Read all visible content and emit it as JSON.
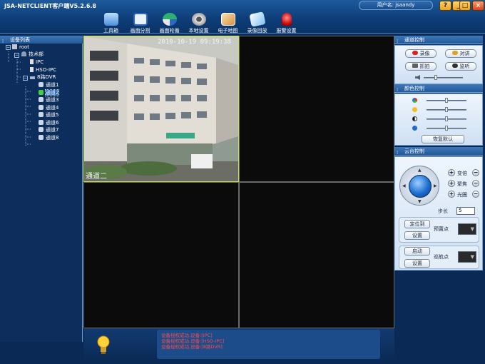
{
  "app": {
    "title": "JSA-NETCLIENT客户端V5.2.6.8",
    "user": "用户名: jsaandy"
  },
  "window_buttons": {
    "help": "?",
    "minimize": "_",
    "maximize": "□",
    "close": "×"
  },
  "toolbar": [
    {
      "label": "工具箱",
      "icon": "toolbox-icon",
      "color": "#5aa0e0"
    },
    {
      "label": "画面分割",
      "icon": "split-screen-icon",
      "color": "#5aa0e0"
    },
    {
      "label": "画面轮循",
      "icon": "cycle-icon",
      "color": "#2fa870"
    },
    {
      "label": "本地设置",
      "icon": "gear-icon",
      "color": "#d8d8d8"
    },
    {
      "label": "电子地图",
      "icon": "map-icon",
      "color": "#f0c080"
    },
    {
      "label": "录像回放",
      "icon": "playback-icon",
      "color": "#7cc0f0"
    },
    {
      "label": "报警设置",
      "icon": "alarm-icon",
      "color": "#e03030"
    }
  ],
  "left_panel": {
    "header": "设备列表",
    "tree": [
      {
        "label": "root",
        "level": 0,
        "icon": "root-icon"
      },
      {
        "label": "技术部",
        "level": 1,
        "icon": "department-icon"
      },
      {
        "label": "IPC",
        "level": 2,
        "icon": "device-icon"
      },
      {
        "label": "HSO-IPC",
        "level": 2,
        "icon": "device-icon"
      },
      {
        "label": "8路DVR",
        "level": 2,
        "icon": "dvr-icon"
      },
      {
        "label": "通道1",
        "level": 3,
        "icon": "camera-icon"
      },
      {
        "label": "通道2",
        "level": 3,
        "icon": "camera-active-icon",
        "selected": true
      },
      {
        "label": "通道3",
        "level": 3,
        "icon": "camera-icon"
      },
      {
        "label": "通道4",
        "level": 3,
        "icon": "camera-icon"
      },
      {
        "label": "通道5",
        "level": 3,
        "icon": "camera-icon"
      },
      {
        "label": "通道6",
        "level": 3,
        "icon": "camera-icon"
      },
      {
        "label": "通道7",
        "level": 3,
        "icon": "camera-icon"
      },
      {
        "label": "通道8",
        "level": 3,
        "icon": "camera-icon"
      }
    ]
  },
  "video": {
    "timestamp": "2010-10-19 09:19:38",
    "channel_label": "通道二"
  },
  "status": {
    "log": [
      "设备授权成功,设备:[IPC]",
      "设备授权成功,设备:[HSO-IPC]",
      "设备授权成功,设备:[8路DVR]"
    ]
  },
  "right_panel": {
    "channel_control": {
      "header": "通道控制",
      "record": "录像",
      "talk": "对讲",
      "snapshot": "抓拍",
      "listen": "监听",
      "volume_level": 0.3
    },
    "color_control": {
      "header": "颜色控制",
      "levels": [
        0.5,
        0.5,
        0.5,
        0.5
      ],
      "restore": "恢复默认"
    },
    "ptz_control": {
      "header": "云台控制",
      "zoom": "变倍",
      "focus": "聚焦",
      "iris": "光圈",
      "step_label": "步长",
      "step_value": "5",
      "goto_preset": "定位到",
      "set_preset": "设置",
      "preset_label": "预置点",
      "start_cruise": "启动",
      "set_cruise": "设置",
      "cruise_label": "巡航点"
    }
  }
}
